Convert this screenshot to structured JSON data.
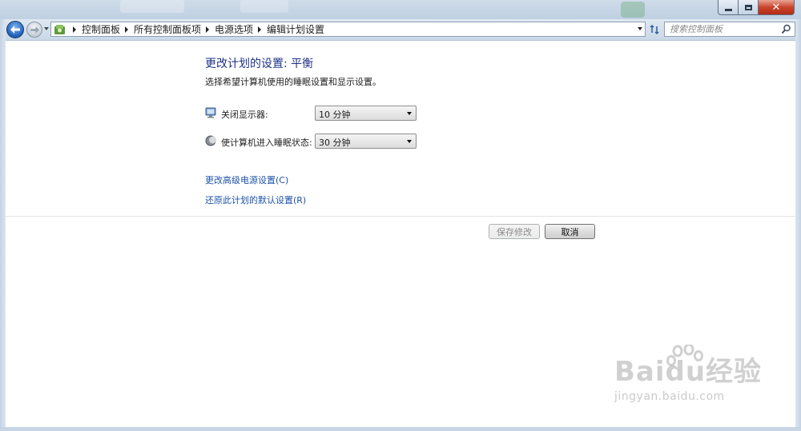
{
  "window": {
    "minimize_icon": "minimize-icon",
    "maximize_icon": "maximize-icon",
    "close_icon": "close-icon"
  },
  "nav": {
    "breadcrumbs": [
      "控制面板",
      "所有控制面板项",
      "电源选项",
      "编辑计划设置"
    ],
    "search_placeholder": "搜索控制面板"
  },
  "main": {
    "title": "更改计划的设置: 平衡",
    "subtitle": "选择希望计算机使用的睡眠设置和显示设置。",
    "settings": [
      {
        "label": "关闭显示器:",
        "value": "10 分钟",
        "icon": "monitor-icon"
      },
      {
        "label": "使计算机进入睡眠状态:",
        "value": "30 分钟",
        "icon": "moon-icon"
      }
    ],
    "links": [
      "更改高级电源设置(C)",
      "还原此计划的默认设置(R)"
    ],
    "save_label": "保存修改",
    "cancel_label": "取消"
  },
  "watermark": {
    "brand": "Baidu经验",
    "url": "jingyan.baidu.com"
  },
  "colors": {
    "heading": "#1e3287",
    "link": "#1c52a9",
    "chrome": "#cad8e6"
  }
}
